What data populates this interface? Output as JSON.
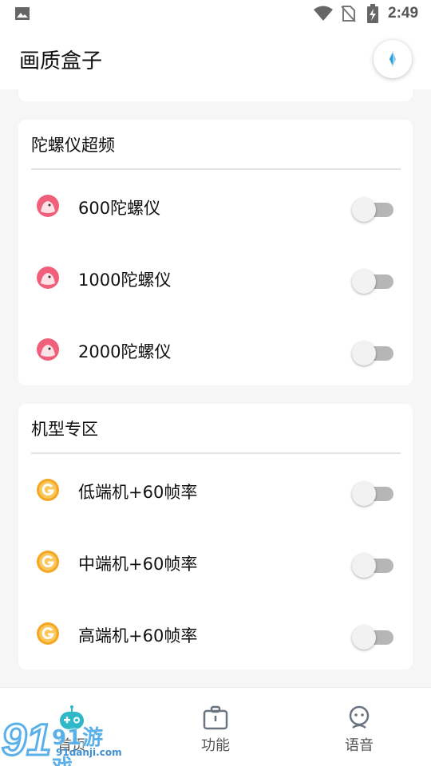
{
  "status_bar": {
    "time": "2:49",
    "icons": [
      "image-icon",
      "wifi-icon",
      "no-sim-icon",
      "battery-charging-icon"
    ]
  },
  "header": {
    "title": "画质盒子",
    "fab_icon": "compass-icon"
  },
  "gyro_section": {
    "title": "陀螺仪超频",
    "items": [
      {
        "label": "600陀螺仪",
        "icon": "pink-bird-icon",
        "enabled": false
      },
      {
        "label": "1000陀螺仪",
        "icon": "pink-bird-icon",
        "enabled": false
      },
      {
        "label": "2000陀螺仪",
        "icon": "pink-bird-icon",
        "enabled": false
      }
    ]
  },
  "model_section": {
    "title": "机型专区",
    "items": [
      {
        "label": "低端机+60帧率",
        "icon": "orange-g-icon",
        "enabled": false
      },
      {
        "label": "中端机+60帧率",
        "icon": "orange-g-icon",
        "enabled": false
      },
      {
        "label": "高端机+60帧率",
        "icon": "orange-g-icon",
        "enabled": false
      }
    ]
  },
  "bottom_nav": {
    "items": [
      {
        "label": "首页",
        "icon": "gamepad-icon",
        "active": true
      },
      {
        "label": "功能",
        "icon": "toolbox-icon",
        "active": false
      },
      {
        "label": "语音",
        "icon": "face-icon",
        "active": false
      }
    ]
  },
  "watermark": {
    "text": "91游戏",
    "url": "91danji.com"
  },
  "colors": {
    "toggle_track_off": "#b6b6b6",
    "toggle_knob": "#f2f2f2",
    "gyro_icon": "#f0607a",
    "model_icon": "#f5a623",
    "nav_active": "#2fb8c8"
  }
}
